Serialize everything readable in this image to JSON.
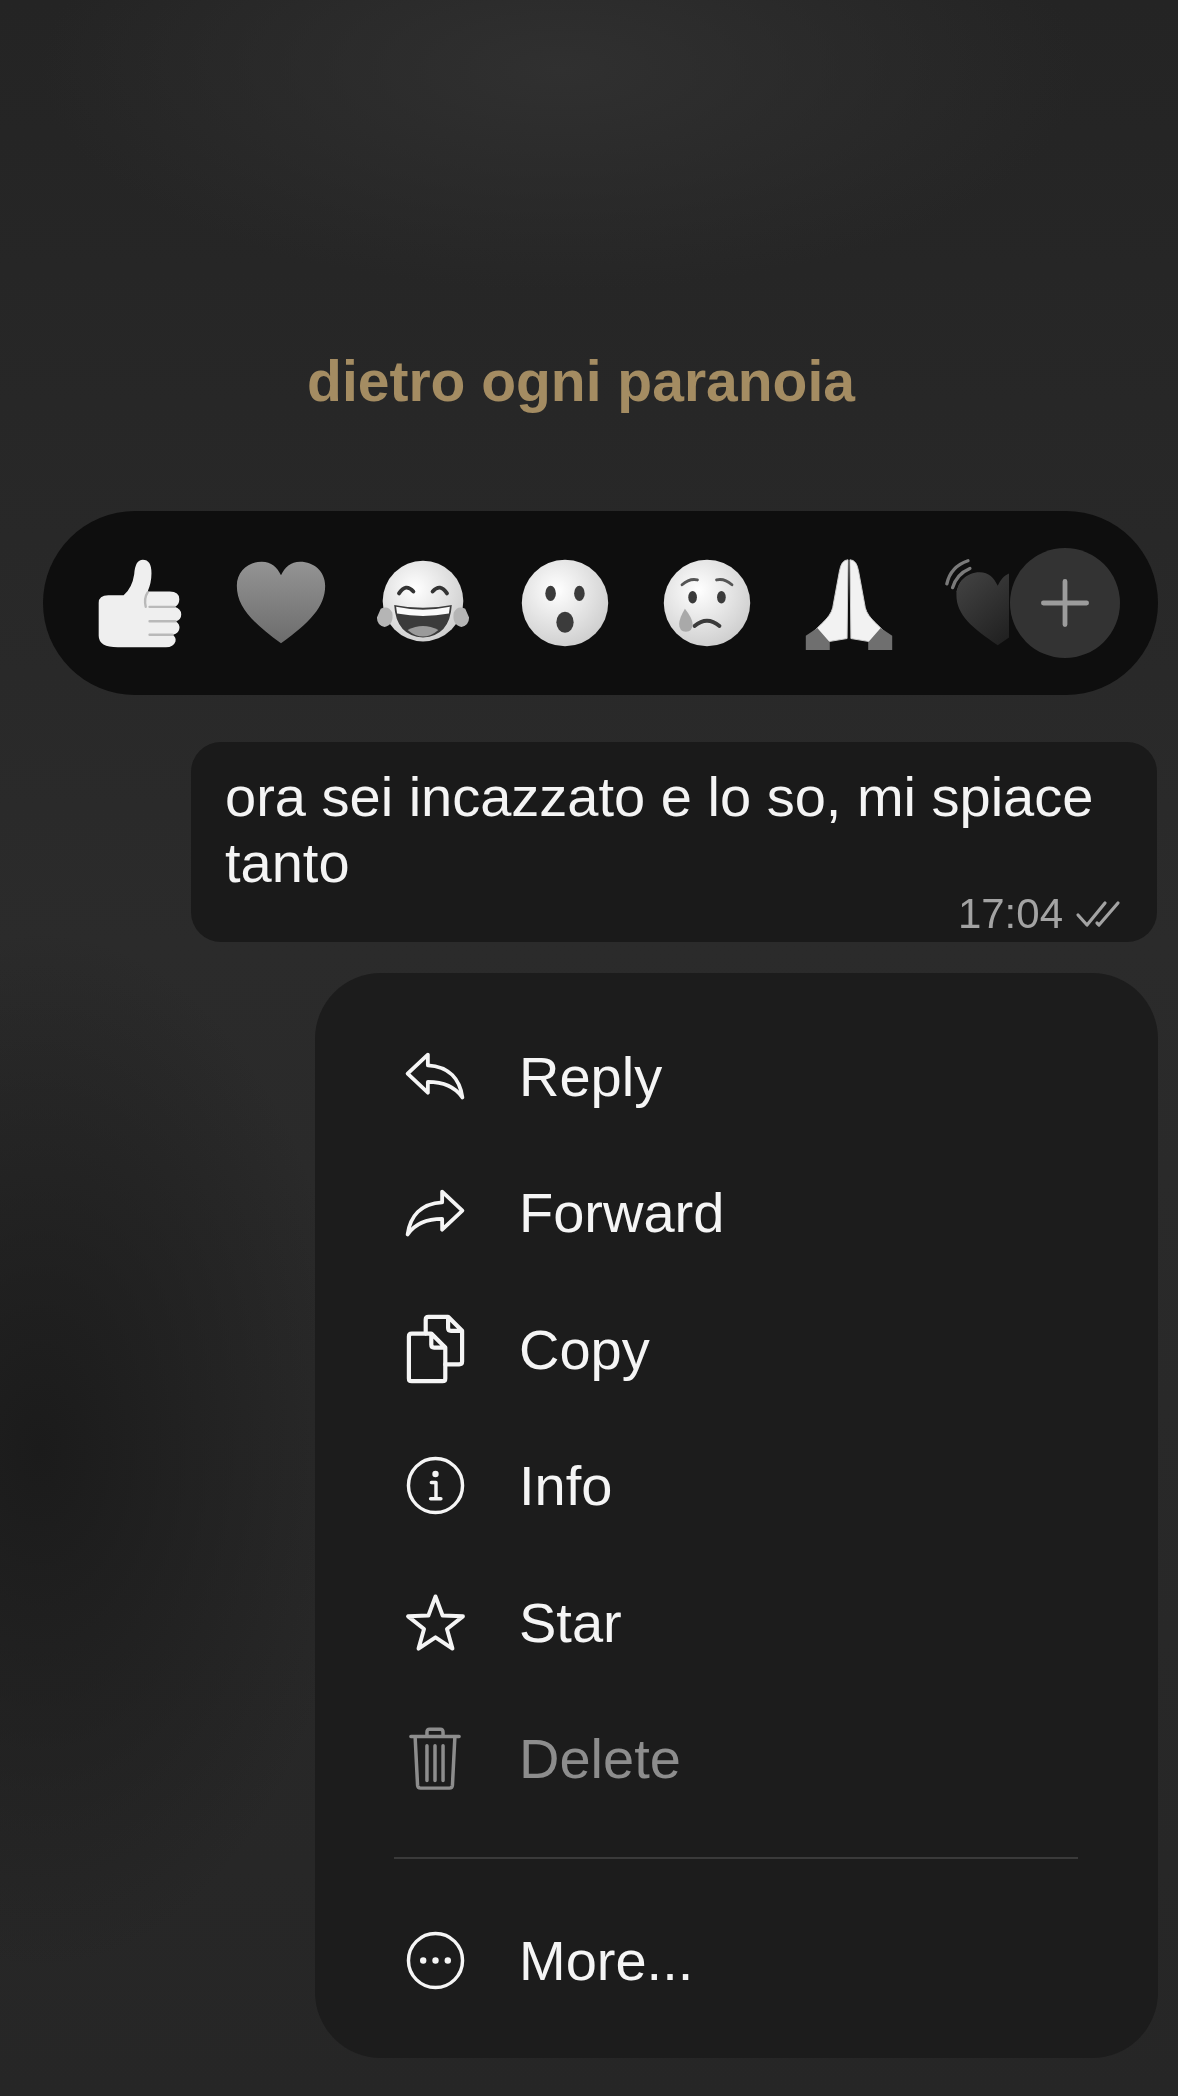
{
  "chat_title": "dietro ogni paranoia",
  "reactions": [
    {
      "kind": "thumbs_up"
    },
    {
      "kind": "heart"
    },
    {
      "kind": "laughing"
    },
    {
      "kind": "surprised"
    },
    {
      "kind": "crying"
    },
    {
      "kind": "praying"
    },
    {
      "kind": "beating_heart"
    }
  ],
  "message": {
    "text": "ora sei incazzato e lo so, mi spiace tanto",
    "time": "17:04",
    "delivered": true,
    "read": false
  },
  "menu": {
    "sections": [
      {
        "items": [
          {
            "label": "Reply",
            "kind": "reply",
            "disabled": false
          },
          {
            "label": "Forward",
            "kind": "forward",
            "disabled": false
          },
          {
            "label": "Copy",
            "kind": "copy",
            "disabled": false
          },
          {
            "label": "Info",
            "kind": "info",
            "disabled": false
          },
          {
            "label": "Star",
            "kind": "star",
            "disabled": false
          },
          {
            "label": "Delete",
            "kind": "delete",
            "disabled": true
          }
        ]
      },
      {
        "items": [
          {
            "label": "More...",
            "kind": "more",
            "disabled": false
          }
        ]
      }
    ]
  }
}
